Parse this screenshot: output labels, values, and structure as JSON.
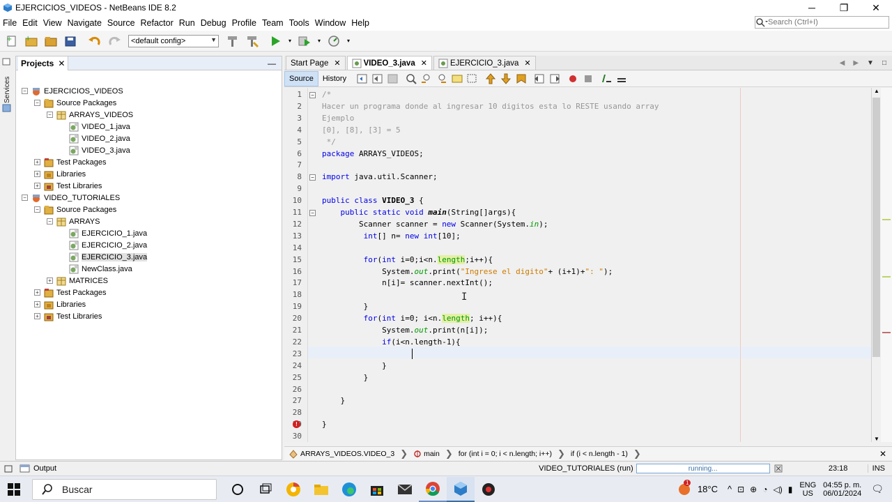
{
  "window": {
    "title": "EJERCICIOS_VIDEOS - NetBeans IDE 8.2"
  },
  "menu": [
    "File",
    "Edit",
    "View",
    "Navigate",
    "Source",
    "Refactor",
    "Run",
    "Debug",
    "Profile",
    "Team",
    "Tools",
    "Window",
    "Help"
  ],
  "search": {
    "placeholder": "Search (Ctrl+I)"
  },
  "toolbar": {
    "config": "<default config>"
  },
  "projects": {
    "tab_label": "Projects",
    "tree": [
      {
        "label": "EJERCICIOS_VIDEOS",
        "icon": "project-icon",
        "depth": 0,
        "exp": "−"
      },
      {
        "label": "Source Packages",
        "icon": "source-packages-icon",
        "depth": 1,
        "exp": "−"
      },
      {
        "label": "ARRAYS_VIDEOS",
        "icon": "package-icon",
        "depth": 2,
        "exp": "−"
      },
      {
        "label": "VIDEO_1.java",
        "icon": "java-file-icon",
        "depth": 3,
        "exp": ""
      },
      {
        "label": "VIDEO_2.java",
        "icon": "java-file-icon",
        "depth": 3,
        "exp": ""
      },
      {
        "label": "VIDEO_3.java",
        "icon": "java-file-icon",
        "depth": 3,
        "exp": ""
      },
      {
        "label": "Test Packages",
        "icon": "test-packages-icon",
        "depth": 1,
        "exp": "+"
      },
      {
        "label": "Libraries",
        "icon": "libraries-icon",
        "depth": 1,
        "exp": "+"
      },
      {
        "label": "Test Libraries",
        "icon": "test-libraries-icon",
        "depth": 1,
        "exp": "+"
      },
      {
        "label": "VIDEO_TUTORIALES",
        "icon": "project-icon",
        "depth": 0,
        "exp": "−"
      },
      {
        "label": "Source Packages",
        "icon": "source-packages-icon",
        "depth": 1,
        "exp": "−"
      },
      {
        "label": "ARRAYS",
        "icon": "package-icon",
        "depth": 2,
        "exp": "−"
      },
      {
        "label": "EJERCICIO_1.java",
        "icon": "java-file-icon",
        "depth": 3,
        "exp": ""
      },
      {
        "label": "EJERCICIO_2.java",
        "icon": "java-file-icon",
        "depth": 3,
        "exp": ""
      },
      {
        "label": "EJERCICIO_3.java",
        "icon": "java-file-icon",
        "depth": 3,
        "exp": "",
        "selected": true
      },
      {
        "label": "NewClass.java",
        "icon": "java-file-icon",
        "depth": 3,
        "exp": ""
      },
      {
        "label": "MATRICES",
        "icon": "package-icon",
        "depth": 2,
        "exp": "+"
      },
      {
        "label": "Test Packages",
        "icon": "test-packages-icon",
        "depth": 1,
        "exp": "+"
      },
      {
        "label": "Libraries",
        "icon": "libraries-icon",
        "depth": 1,
        "exp": "+"
      },
      {
        "label": "Test Libraries",
        "icon": "test-libraries-icon",
        "depth": 1,
        "exp": "+"
      }
    ]
  },
  "services_label": "Services",
  "editor": {
    "tabs": [
      {
        "label": "Start Page",
        "active": false
      },
      {
        "label": "VIDEO_3.java",
        "active": true
      },
      {
        "label": "EJERCICIO_3.java",
        "active": false
      }
    ],
    "modes": {
      "source": "Source",
      "history": "History"
    },
    "lines": [
      "/*",
      "Hacer un programa donde al ingresar 10 digitos esta lo RESTE usando array",
      "Ejemplo",
      "[0], [8], [3] = 5",
      " */",
      "package ARRAYS_VIDEOS;",
      "",
      "import java.util.Scanner;",
      "",
      "public class VIDEO_3 {",
      "    public static void main(String[]args){",
      "        Scanner scanner = new Scanner(System.in);",
      "         int[] n= new int[10];",
      "",
      "         for(int i=0;i<n.length;i++){",
      "             System.out.print(\"Ingrese el digito\"+ (i+1)+\": \");",
      "             n[i]= scanner.nextInt();",
      "",
      "         }",
      "         for(int i=0; i<n.length; i++){",
      "             System.out.print(n[i]);",
      "             if(i<n.length-1){",
      "                 ",
      "             }",
      "         }",
      "",
      "    }",
      "",
      "}",
      ""
    ],
    "current_line": 23
  },
  "breadcrumb": [
    "ARRAYS_VIDEOS.VIDEO_3",
    "main",
    "for (int i = 0; i < n.length; i++)",
    "if (i < n.length - 1)"
  ],
  "status": {
    "output_label": "Output",
    "run_label": "VIDEO_TUTORIALES (run)",
    "progress_text": "running...",
    "caret": "23:18",
    "insert_mode": "INS"
  },
  "taskbar": {
    "search_placeholder": "Buscar",
    "weather": "18°C",
    "lang1": "ENG",
    "lang2": "US",
    "time": "04:55 p. m.",
    "date": "06/01/2024",
    "badge": "1"
  }
}
